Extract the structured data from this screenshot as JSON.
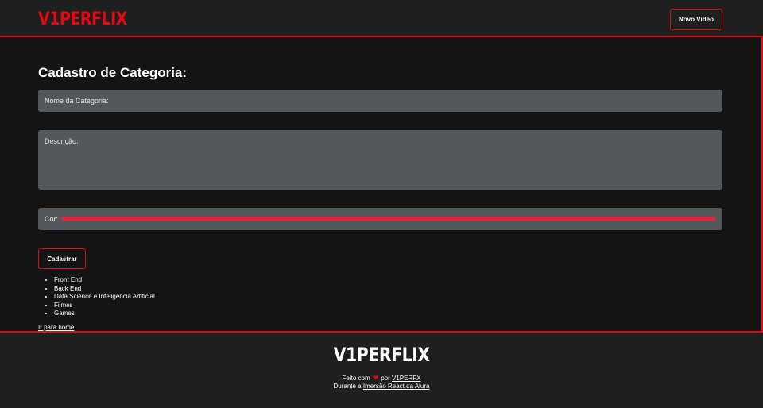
{
  "header": {
    "logo": "V1PERFLIX",
    "new_video_label": "Novo Vídeo"
  },
  "form": {
    "title": "Cadastro de Categoria:",
    "name_label": "Nome da Categoria:",
    "description_label": "Descrição:",
    "color_label": "Cor:",
    "color_value": "#e5233a",
    "submit_label": "Cadastrar"
  },
  "categories": [
    "Front End",
    "Back End",
    "Data Science e Inteligência Artificial",
    "Filmes",
    "Games"
  ],
  "home_link": "Ir para home",
  "footer": {
    "logo": "V1PERFLIX",
    "made_with": "Feito com",
    "heart_icon": "heart-icon",
    "by": "por",
    "author_link": "V1PERFX",
    "during": "Durante a",
    "event_link": "Imersão React da Alura"
  },
  "colors": {
    "accent": "#e50914",
    "background": "#141414",
    "bar_background": "#1f1f1f",
    "input_background": "#53585d"
  }
}
